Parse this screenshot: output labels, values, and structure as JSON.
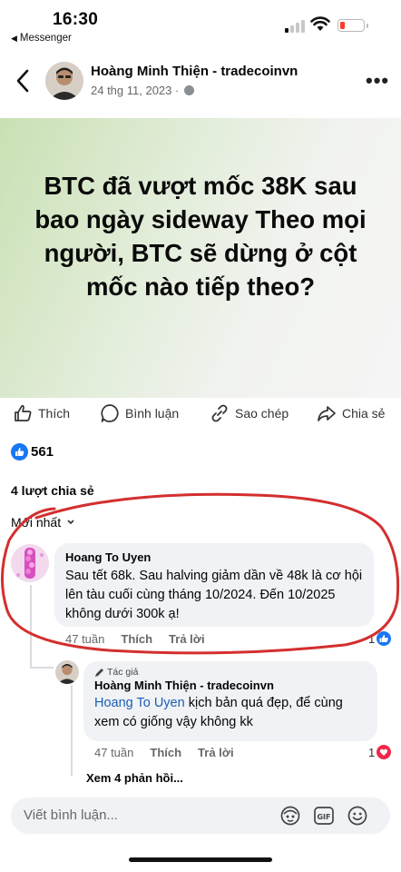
{
  "status_bar": {
    "time": "16:30",
    "back_app": "Messenger"
  },
  "post": {
    "author": "Hoàng Minh Thiện - tradecoinvn",
    "date": "24 thg 11, 2023 · ",
    "image_text": "BTC đã vượt mốc 38K sau bao ngày sideway Theo mọi người, BTC sẽ dừng ở cột mốc nào tiếp theo?",
    "actions": {
      "like": "Thích",
      "comment": "Bình luận",
      "copy": "Sao chép",
      "share": "Chia sẻ"
    },
    "reaction_count": "561",
    "share_count": "4 lượt chia sẻ",
    "sort_label": "Mới nhất"
  },
  "comments": [
    {
      "name": "Hoang To Uyen",
      "text": "Sau tết 68k. Sau halving giảm dần về 48k là cơ hội lên tàu cuối cùng tháng 10/2024. Đến 10/2025 không dưới 300k ạ!",
      "time": "47 tuần",
      "like": "Thích",
      "reply": "Trả lời",
      "reactions": "1"
    }
  ],
  "reply": {
    "badge": "Tác giả",
    "name": "Hoàng Minh Thiện - tradecoinvn",
    "mention": "Hoang To Uyen",
    "text": " kịch bản quá đẹp, để cùng xem có giống vậy không kk",
    "time": "47 tuần",
    "like": "Thích",
    "reply": "Trả lời",
    "reactions": "1"
  },
  "see_more_replies": "Xem 4 phản hồi...",
  "composer": {
    "placeholder": "Viết bình luận..."
  },
  "colors": {
    "accent": "#1877f2",
    "annotation": "#d32f2f",
    "heart": "#f0284a"
  }
}
